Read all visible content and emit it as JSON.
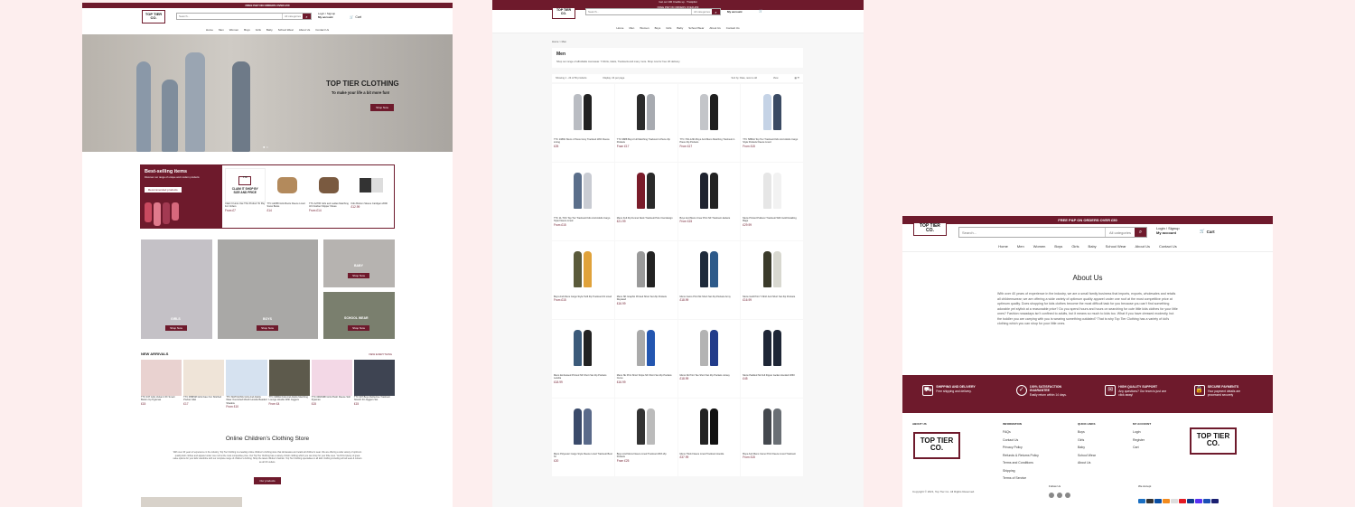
{
  "site": {
    "promo": "FREE P&P ON ORDERS OVER £50",
    "logo_line1": "TOP TIER",
    "logo_line2": "CO.",
    "search_placeholder": "Search...",
    "category_select": "All categories",
    "account_top": "Login / Signup",
    "account_bottom": "My account",
    "cart_label": "Cart",
    "cart_count": "0",
    "nav": [
      "Home",
      "Men",
      "Women",
      "Boys",
      "Girls",
      "Baby",
      "School Wear",
      "About Us",
      "Contact Us"
    ]
  },
  "home": {
    "hero_title": "TOP TIER CLOTHING",
    "hero_sub": "To make your life a bit more fun!",
    "hero_button": "Shop Now",
    "bestselling_title": "Best-selling items",
    "bestselling_sub": "Discover our range of unique and modern products",
    "bestselling_button": "Recommended products",
    "claim_text": "CLAIM IT SHOP BY SIZE AND PRICE",
    "bestselling_items": [
      {
        "name": "Claim It Here Use This Product To Pay For Orders",
        "price": "From £7"
      },
      {
        "name": "TTC A2058 Girls Boots Fleece Lined Snow Boots",
        "price": "£14"
      },
      {
        "name": "TTC A2765 Girls and Ladies Matching 3/4 Outdoor Slipper Shoes",
        "price": "From £14"
      },
      {
        "name": "Kids Bottom Sleeve Cardigan 2090",
        "price": "£12.99"
      }
    ],
    "categories": [
      "GIRLS",
      "BOYS",
      "BABY",
      "SCHOOL WEAR"
    ],
    "category_button": "Shop Now",
    "new_arrivals_title": "NEW ARRIVALS",
    "new_arrivals_link": "VIEW EVERYTHING",
    "arrivals": [
      {
        "name": "TTC 047 Girls Velvet 2 Pc Smart Button Up Pyjamas",
        "price": "£15"
      },
      {
        "name": "TTC 058P48 Girls Faux Fur Stitched Pocket Gilet",
        "price": "£17"
      },
      {
        "name": "TTC MATCHING Girls And Adults Wear Oversized Mouth Hoodie Beaded Shadow",
        "price": "From £10"
      },
      {
        "name": "TTC 0286H Kids And Adults Matching Lounge Hoodie With Joggers",
        "price": "From £4"
      },
      {
        "name": "TTC 096/04BI Girls Plush Fleece Soft Pyjamas",
        "price": "£15"
      },
      {
        "name": "TTC 997 Boys Reflective Tracksuit Stretch Fit Joggers Set",
        "price": "£15"
      }
    ],
    "store_title": "Online Children's Clothing Store",
    "store_text": "With over 40 years of experience in the industry, Top Tier Clothing is a leading online children's clothing store that wholesales and retails all children's wear. We are offering a wide variety of optimum quality kids' clothes and apparel under one roof at the most competitive price. Our Top Tier Clothing has a variety of kids' clothing which you can shop for your little ones. You'll find plenty of great value options for your kids' wardrobe with our complete range of children's clothing. Shop the latest children's fashion. Top Tier Clothing specialises in all kids' clothing including school wear & colours as all UK outlets.",
    "store_button": "Our products"
  },
  "men": {
    "promo_top": "Get our 100 Credits up · Trustpilot",
    "breadcrumb": "Home > Men",
    "title": "Men",
    "description": "Shop our range of affordable menswear. T-Shirts, Gilets, Tracksuits and many more. Shop now for free UK delivery.",
    "showing": "Showing 1 - 24 of 56 products",
    "display": "Display: 24 per page",
    "sort": "Sort by: Date, new to old",
    "view": "View",
    "products": [
      {
        "name": "TTC 1089C Mens 2 Piece Grey Tracksuit With Fleece Lining",
        "price": "£25"
      },
      {
        "name": "TTC 9888 Boys Full Matching Tracksuit 2-Piece Zip Pockets",
        "price": "From £17"
      },
      {
        "name": "TTC 7R1-1291 Boys And Mens Matching Tracksuit 2-Piece Zip Pockets",
        "price": "From £17"
      },
      {
        "name": "TTC 5880H Top Tier Tracksuit Kids And Adults Cargo Style Pockets Fleece Lined",
        "price": "From £15"
      },
      {
        "name": "TTC 11-TOC Top Tier Tracksuit Kids And Adults Cargo Style Fleece Lined",
        "price": "From £15"
      },
      {
        "name": "Mens Full Zip Funnel Neck Tracksuit Polo Overdesign",
        "price": "£21.99"
      },
      {
        "name": "Boys And Mens Crew Print NF Tracksuit Jackets",
        "price": "From £15"
      },
      {
        "name": "Mens Printed Pullover Tracksuit With Gold Detailing Bags",
        "price": "£29.99"
      },
      {
        "name": "Boys And Mens Cargo Style Twill Zip Tracksuit Fit Lined",
        "price": "From £15"
      },
      {
        "name": "Mens NK Graphic Printed Short Set Zip Pockets Reyased",
        "price": "£16.99"
      },
      {
        "name": "Mens Camo Print Nk Short Set Zip Pockets Army",
        "price": "£18.99"
      },
      {
        "name": "Mens Gold Print T-Shirt And Short Set Zip Pockets",
        "price": "£16.99"
      },
      {
        "name": "Mens Embossed Printed NK Short Set Zip Pockets Landra",
        "price": "£18.99"
      },
      {
        "name": "Mens Nk Print Short Stripe NK Short Set Zip Pockets Curve",
        "price": "£16.99"
      },
      {
        "name": "Mens Nk Print Tee Short Set Zip Pockets Jersey",
        "price": "£18.99"
      },
      {
        "name": "Mens Padded Nk Full Zipper Jacket Hooded 1860",
        "price": "£45"
      },
      {
        "name": "Mens Polyester Cargo Style Fleece Lined Tracksuit Best NI",
        "price": "£20"
      },
      {
        "name": "Boys And Mens Fleece Lined Tracksuit With Zip Pockets",
        "price": "From £25"
      },
      {
        "name": "Mens Thick Fleece Lined Tracksuit Hoodie",
        "price": "£37.99"
      },
      {
        "name": "Boys And Mens Camo Print Fleece Lined Tracksuit",
        "price": "From £15"
      }
    ]
  },
  "about": {
    "title": "About Us",
    "text": "With over 40 years of experience in the industry, we are a small family business that imports, exports, wholesales and retails all childrenswear; we are offering a wide variety of optimum quality apparel under one roof at the most competitive price at optimum quality. Does shopping for kids clothes become the most difficult task for you because you can't find something adorable yet stylish at a reasonable price? Do you spend hours and hours on searching for cute little kids clothes for your little ones? Fashion nowadays isn't confined to adults, but it means so much to kids too. What if you have dressed modestly, but the toddler you are carrying with you is wearing something outdated? That is why Top Tier Clothing has a variety of kid's clothing which you can shop for your little ones.",
    "features": [
      {
        "title": "SHIPPING AND DELIVERY",
        "text": "Free shipping and delivery."
      },
      {
        "title": "100% SATISFACTION GUARANTEE",
        "text": "Easily return within 14 days."
      },
      {
        "title": "HIGH QUALITY SUPPORT",
        "text": "Any questions? Our team is just one click away!"
      },
      {
        "title": "SECURE PAYMENTS",
        "text": "Your payment details are processed securely"
      }
    ],
    "footer_about": "ABOUT US",
    "footer_info_title": "INFORMATION",
    "footer_info": [
      "FAQs",
      "Contact Us",
      "Privacy Policy",
      "Refunds & Returns Policy",
      "Terms and Conditions",
      "Shipping",
      "Terms of Service"
    ],
    "footer_quick_title": "QUICK LINKS",
    "footer_quick": [
      "Boys",
      "Girls",
      "Baby",
      "School Wear",
      "About Us"
    ],
    "footer_account_title": "MY ACCOUNT",
    "footer_account": [
      "Login",
      "Register",
      "Cart"
    ],
    "follow": "Follow Us",
    "we_accept": "We Accept",
    "copyright": "Copyright © 2021, Top Tier Co. All Rights Reserved."
  },
  "colors": {
    "brand": "#6e1a2c",
    "page_bg": "#fdeeee"
  }
}
